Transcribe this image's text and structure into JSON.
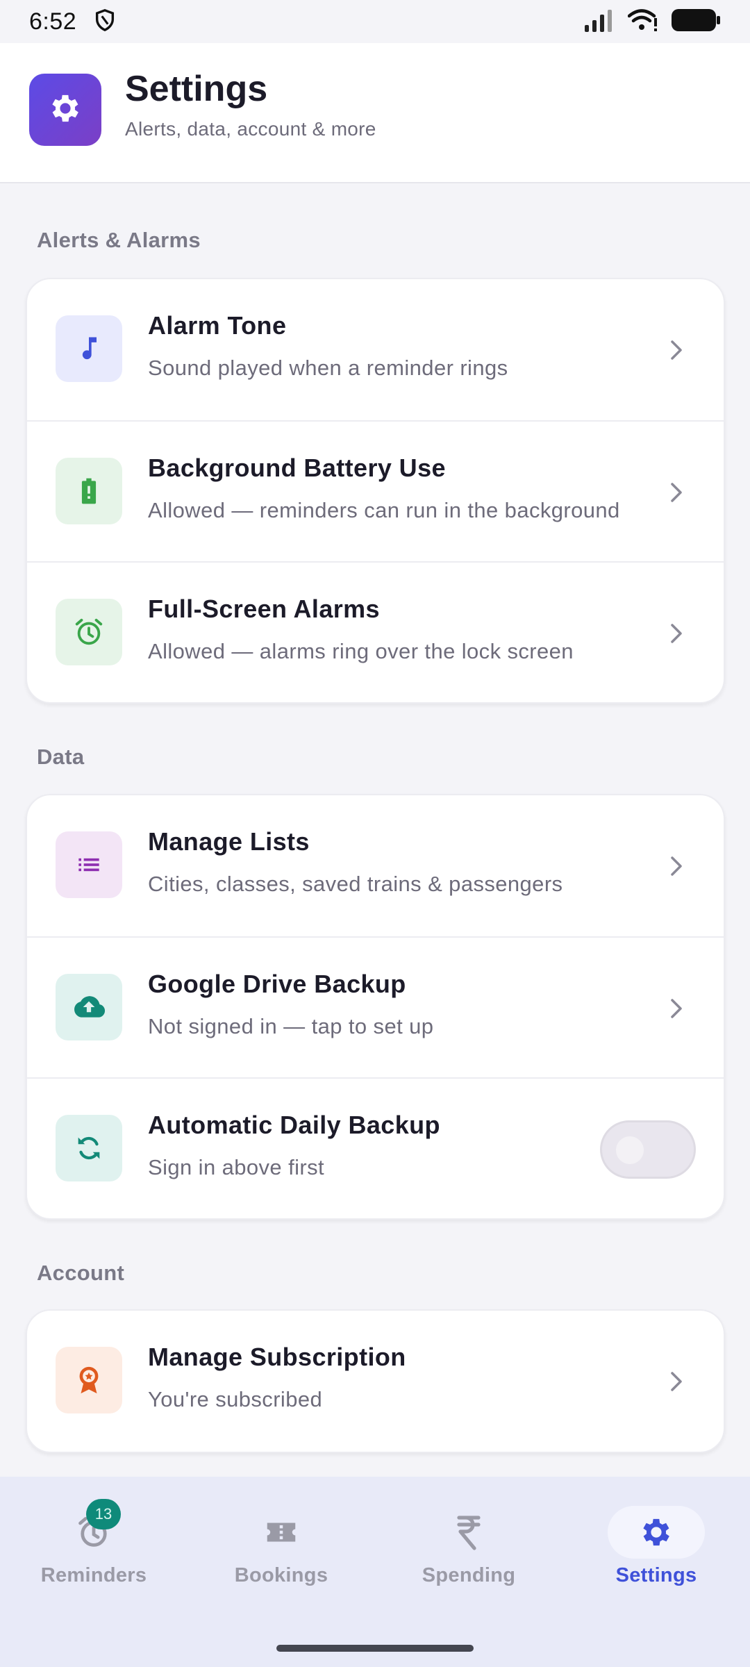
{
  "status_bar": {
    "time": "6:52"
  },
  "header": {
    "title": "Settings",
    "subtitle": "Alerts, data, account & more",
    "logo_icon": "gear-icon"
  },
  "sections": [
    {
      "label": "Alerts & Alarms",
      "rows": [
        {
          "title": "Alarm Tone",
          "subtitle": "Sound played when a reminder rings",
          "icon": "music-note-icon",
          "color": "#3f51d9",
          "bg": "#e8eafd"
        },
        {
          "title": "Background Battery Use",
          "subtitle": "Allowed — reminders can run in the background",
          "icon": "battery-icon",
          "color": "#3aa64a",
          "bg": "#e6f4e8"
        },
        {
          "title": "Full-Screen Alarms",
          "subtitle": "Allowed — alarms ring over the lock screen",
          "icon": "alarm-clock-icon",
          "color": "#3aa64a",
          "bg": "#e6f4e8"
        }
      ]
    },
    {
      "label": "Data",
      "rows": [
        {
          "title": "Manage Lists",
          "subtitle": "Cities, classes, saved trains & passengers",
          "icon": "list-icon",
          "color": "#8e2fb0",
          "bg": "#f3e5f6"
        },
        {
          "title": "Google Drive Backup",
          "subtitle": "Not signed in — tap to set up",
          "icon": "cloud-upload-icon",
          "color": "#138a78",
          "bg": "#e0f2ef"
        },
        {
          "title": "Automatic Daily Backup",
          "subtitle": "Sign in above first",
          "icon": "sync-icon",
          "color": "#138a78",
          "bg": "#e0f2ef",
          "toggle": false
        }
      ]
    },
    {
      "label": "Account",
      "rows": [
        {
          "title": "Manage Subscription",
          "subtitle": "You're subscribed",
          "icon": "award-badge-icon",
          "color": "#e05a1e",
          "bg": "#fdece3"
        }
      ]
    }
  ],
  "bottom_nav": {
    "items": [
      {
        "label": "Reminders",
        "icon": "alarm-icon",
        "badge": "13",
        "active": false
      },
      {
        "label": "Bookings",
        "icon": "ticket-icon",
        "active": false
      },
      {
        "label": "Spending",
        "icon": "rupee-icon",
        "active": false
      },
      {
        "label": "Settings",
        "icon": "gear-icon",
        "active": true
      }
    ]
  },
  "colors": {
    "accent": "#3f51d9",
    "logo_gradient_start": "#5c4be6",
    "logo_gradient_end": "#7b3fc6",
    "badge": "#0f8a7a"
  }
}
